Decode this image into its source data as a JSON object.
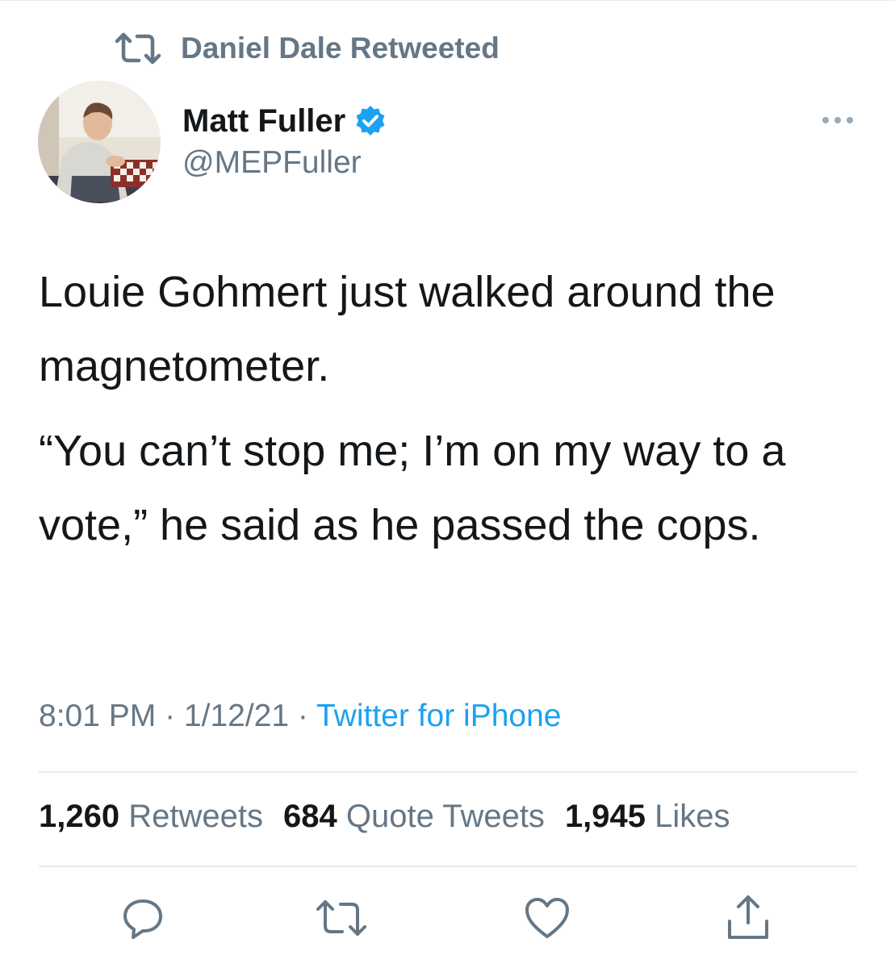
{
  "retweet_context": {
    "label": "Daniel Dale Retweeted",
    "icon": "retweet-icon"
  },
  "author": {
    "display_name": "Matt Fuller",
    "handle": "@MEPFuller",
    "verified": true,
    "verified_icon": "verified-badge-icon"
  },
  "tweet": {
    "paragraphs": [
      "Louie Gohmert just walked around the magnetometer.",
      "“You can’t stop me; I’m on my way to a vote,” he said as he passed the cops."
    ]
  },
  "meta": {
    "time": "8:01 PM",
    "separator": " · ",
    "date": "1/12/21",
    "source": "Twitter for iPhone"
  },
  "stats": [
    {
      "count": "1,260",
      "label": "Retweets"
    },
    {
      "count": "684",
      "label": "Quote Tweets"
    },
    {
      "count": "1,945",
      "label": "Likes"
    }
  ],
  "actions": [
    {
      "name": "reply",
      "icon": "reply-icon"
    },
    {
      "name": "retweet",
      "icon": "retweet-icon"
    },
    {
      "name": "like",
      "icon": "heart-icon"
    },
    {
      "name": "share",
      "icon": "share-icon"
    }
  ],
  "colors": {
    "text_primary": "#14171a",
    "text_secondary": "#657786",
    "accent": "#1da1f2",
    "divider": "#e6ecf0"
  }
}
